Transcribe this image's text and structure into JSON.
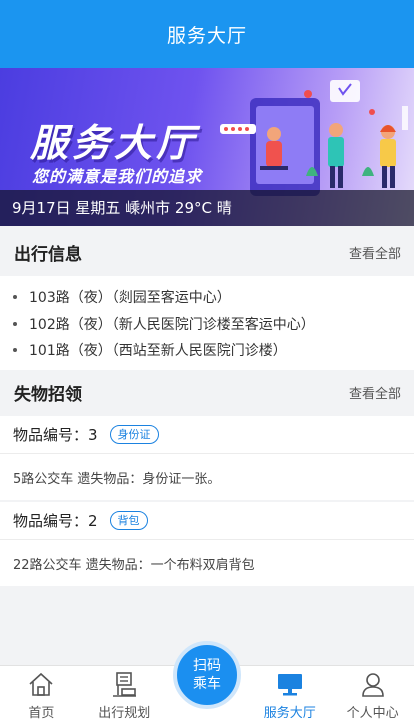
{
  "header": {
    "title": "服务大厅"
  },
  "banner": {
    "title": "服务大厅",
    "subtitle": "您的满意是我们的追求",
    "weather": "9月17日 星期五 嵊州市 29°C 晴"
  },
  "trips": {
    "title": "出行信息",
    "more": "查看全部",
    "items": [
      "103路（夜）（剡园至客运中心）",
      "102路（夜）（新人民医院门诊楼至客运中心）",
      "101路（夜）（西站至新人民医院门诊楼）"
    ]
  },
  "lost": {
    "title": "失物招领",
    "more": "查看全部",
    "items": [
      {
        "id": "物品编号：3",
        "tag": "身份证",
        "desc": "5路公交车 遗失物品：身份证一张。"
      },
      {
        "id": "物品编号：2",
        "tag": "背包",
        "desc": "22路公交车 遗失物品：一个布料双肩背包"
      }
    ]
  },
  "tabbar": {
    "tabs": [
      {
        "label": "首页",
        "icon": "home-icon"
      },
      {
        "label": "出行规划",
        "icon": "bus-stop-icon"
      },
      {
        "label": "",
        "icon": "scan-icon"
      },
      {
        "label": "服务大厅",
        "icon": "monitor-icon",
        "active": true
      },
      {
        "label": "个人中心",
        "icon": "user-icon"
      }
    ],
    "scan_line1": "扫码",
    "scan_line2": "乘车"
  },
  "colors": {
    "accent": "#1b95f0",
    "active_tab": "#1b82e0"
  }
}
